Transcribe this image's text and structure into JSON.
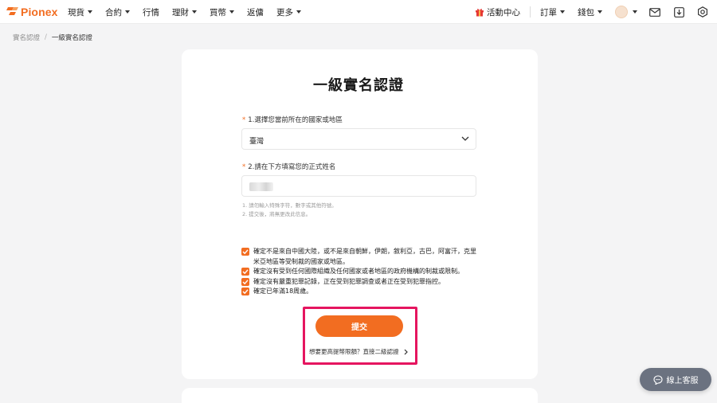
{
  "brand": {
    "name": "Pionex",
    "accent_color": "#f26d21"
  },
  "nav": {
    "left": [
      {
        "label": "現貨",
        "dropdown": true
      },
      {
        "label": "合約",
        "dropdown": true
      },
      {
        "label": "行情",
        "dropdown": false
      },
      {
        "label": "理財",
        "dropdown": true
      },
      {
        "label": "買幣",
        "dropdown": true
      },
      {
        "label": "返傭",
        "dropdown": false
      },
      {
        "label": "更多",
        "dropdown": true
      }
    ],
    "activity_center": "活動中心",
    "orders": "訂單",
    "wallet": "錢包",
    "icons": [
      "gift-icon",
      "avatar",
      "mail-icon",
      "download-icon",
      "settings-icon"
    ]
  },
  "breadcrumb": {
    "parent": "實名認證",
    "separator": "/",
    "current": "一級實名認證"
  },
  "form": {
    "title": "一級實名認證",
    "country_label": "1.選擇您當前所在的國家或地區",
    "country_value": "臺灣",
    "name_label": "2.請在下方填寫您的正式姓名",
    "hint_1": "1. 請勿輸入特殊字符，數字或其他符號。",
    "hint_2": "2. 提交後，將無更改此信息。",
    "checkboxes": [
      {
        "text": "確定不是來自中國大陸，或不是來自朝鮮，伊朗，敘利亞，古巴，阿富汗，克里米亞地區等受制裁的國家或地區。",
        "checked": true
      },
      {
        "text": "確定沒有受到任何國際組織及任何國家或者地區的政府機構的制裁或限制。",
        "checked": true
      },
      {
        "text": "確定沒有嚴重犯罪記錄，正在受到犯罪調查或者正在受到犯罪指控。",
        "checked": true
      },
      {
        "text": "確定已年滿18周歲。",
        "checked": true
      }
    ],
    "submit_label": "提交",
    "advance_link": "想要更高提幣限額？直接二級認證"
  },
  "support": {
    "label": "線上客服"
  },
  "highlight_color": "#e5155f"
}
